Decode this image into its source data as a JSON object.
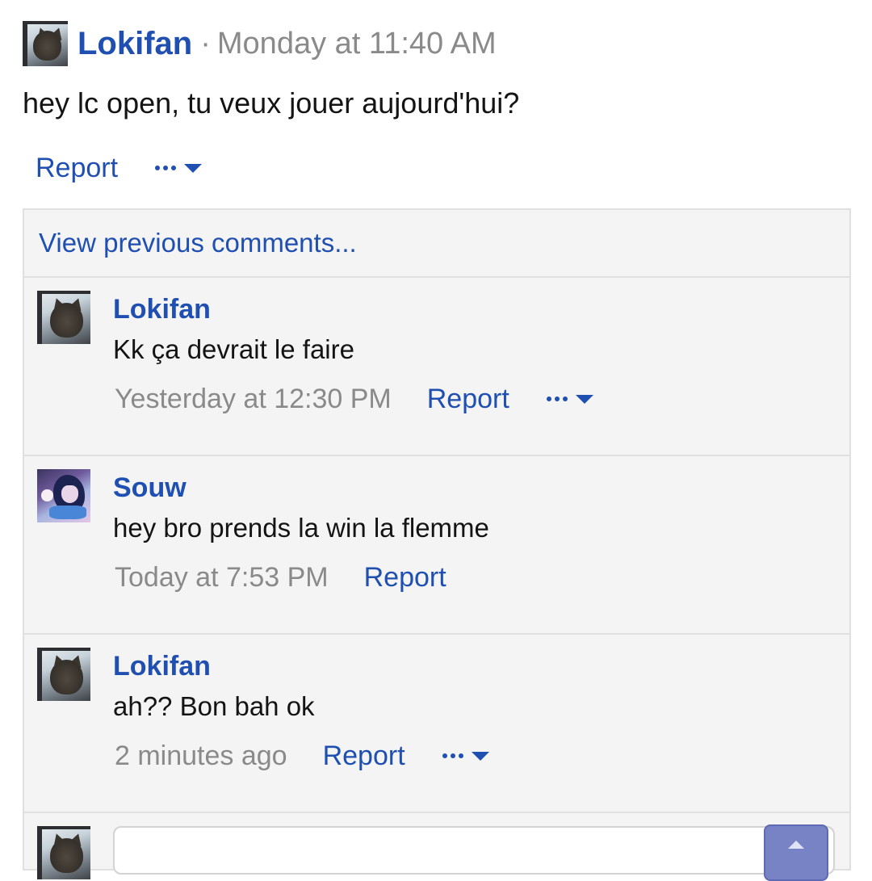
{
  "status": {
    "author": "Lokifan",
    "separator": "·",
    "time": "Monday at 11:40 AM",
    "text": "hey lc open, tu veux jouer aujourd'hui?",
    "report_label": "Report"
  },
  "comments_panel": {
    "view_previous_label": "View previous comments...",
    "comments": [
      {
        "author": "Lokifan",
        "text": "Kk ça devrait le faire",
        "time": "Yesterday at 12:30 PM",
        "report_label": "Report",
        "has_menu": true
      },
      {
        "author": "Souw",
        "text": "hey bro prends la win la flemme",
        "time": "Today at 7:53 PM",
        "report_label": "Report",
        "has_menu": false
      },
      {
        "author": "Lokifan",
        "text": "ah?? Bon bah ok",
        "time": "2 minutes ago",
        "report_label": "Report",
        "has_menu": true
      }
    ],
    "reply": {
      "placeholder": ""
    }
  },
  "icons": {
    "more_menu": "more-options-dots-icon",
    "caret": "caret-down-icon",
    "send": "send-arrow-up-icon"
  },
  "colors": {
    "link": "#1f4fb0",
    "muted_text": "#8a8a8a",
    "panel_background": "#f4f4f4",
    "send_button": "#7883c6"
  }
}
